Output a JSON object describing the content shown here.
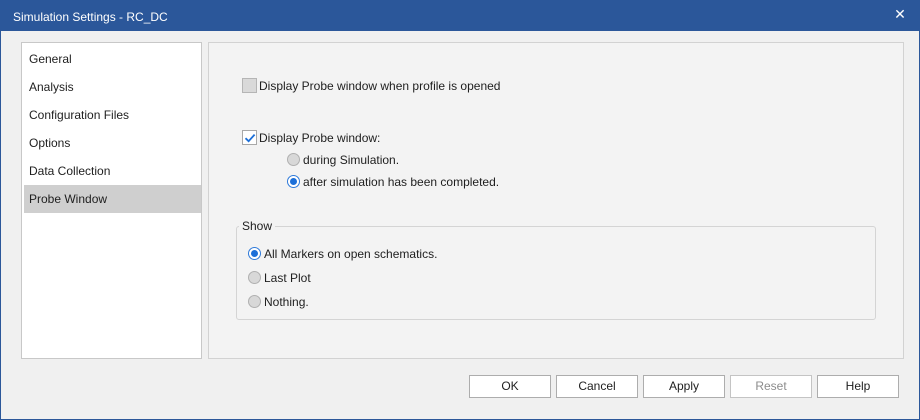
{
  "window": {
    "title": "Simulation Settings - RC_DC",
    "close_glyph": "✕"
  },
  "sidebar": {
    "items": [
      {
        "label": "General",
        "selected": false
      },
      {
        "label": "Analysis",
        "selected": false
      },
      {
        "label": "Configuration Files",
        "selected": false
      },
      {
        "label": "Options",
        "selected": false
      },
      {
        "label": "Data Collection",
        "selected": false
      },
      {
        "label": "Probe Window",
        "selected": true
      }
    ]
  },
  "probe": {
    "open_on_profile": {
      "label": "Display Probe window when profile is opened",
      "checked": false
    },
    "display_probe": {
      "label": "Display Probe window:",
      "checked": true
    },
    "timing": {
      "during": {
        "label": "during Simulation.",
        "selected": false
      },
      "after": {
        "label": "after simulation has been completed.",
        "selected": true
      }
    },
    "show": {
      "title": "Show",
      "all_markers": {
        "label": "All Markers on open schematics.",
        "selected": true
      },
      "last_plot": {
        "label": "Last Plot",
        "selected": false
      },
      "nothing": {
        "label": "Nothing.",
        "selected": false
      }
    }
  },
  "buttons": {
    "ok": "OK",
    "cancel": "Cancel",
    "apply": "Apply",
    "reset": "Reset",
    "help": "Help"
  },
  "colors": {
    "titlebar": "#2b579a",
    "accent": "#1c6fd8",
    "selected_item": "#cfcfcf"
  }
}
